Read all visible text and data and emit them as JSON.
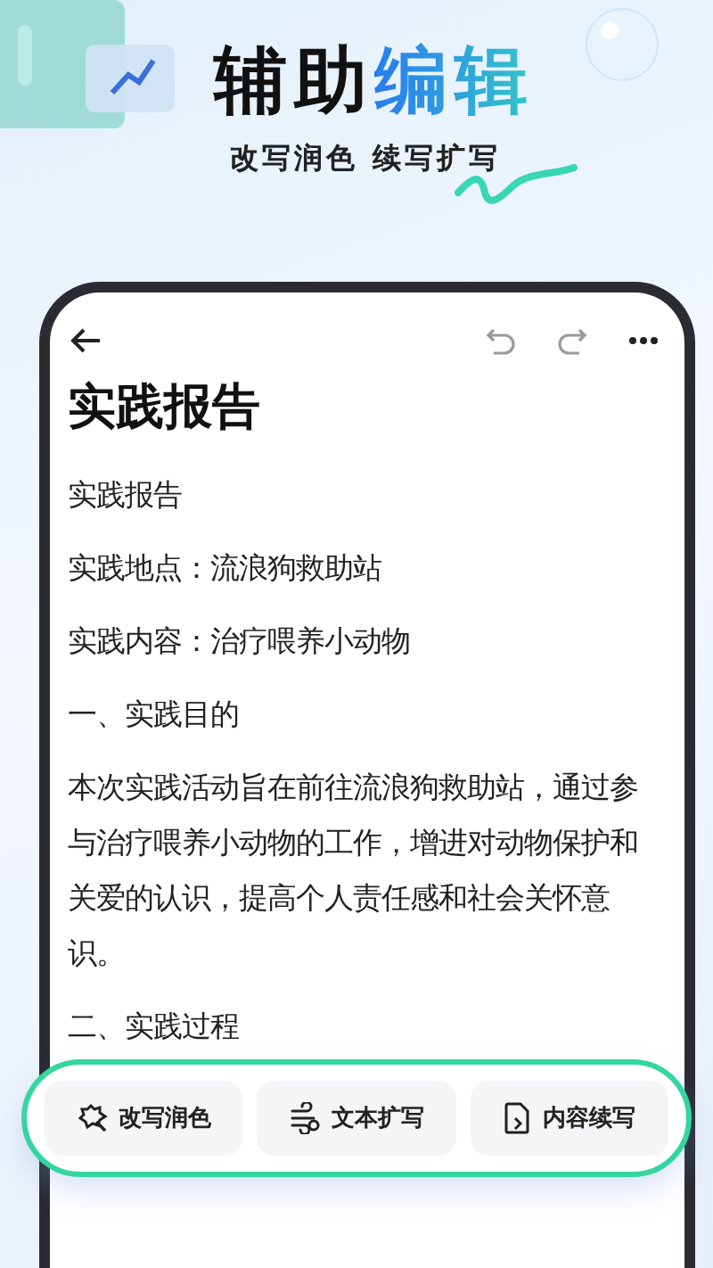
{
  "banner": {
    "headline_dark": "辅助",
    "headline_accent": "编辑",
    "subtitle": "改写润色 续写扩写"
  },
  "document": {
    "title": "实践报告",
    "paragraphs": [
      "实践报告",
      "实践地点：流浪狗救助站",
      "实践内容：治疗喂养小动物",
      "一、实践目的",
      "本次实践活动旨在前往流浪狗救助站，通过参与治疗喂养小动物的工作，增进对动物保护和关爱的认识，提高个人责任感和社会关怀意识。",
      "二、实践过程"
    ]
  },
  "actions": [
    {
      "kind": "polish",
      "label": "改写润色"
    },
    {
      "kind": "expand",
      "label": "文本扩写"
    },
    {
      "kind": "continue",
      "label": "内容续写"
    }
  ]
}
